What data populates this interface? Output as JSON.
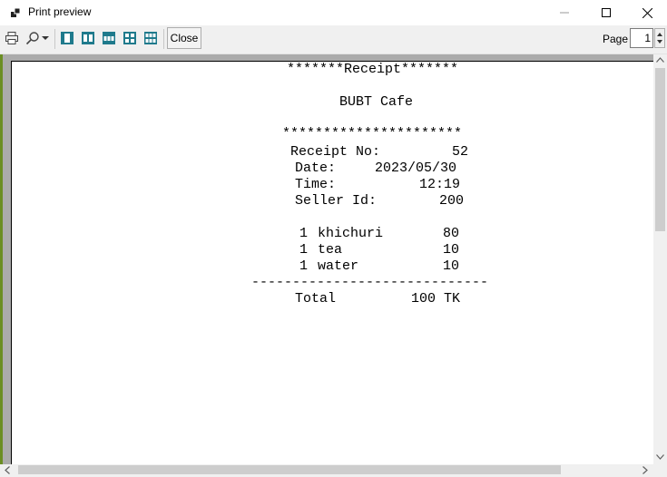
{
  "window": {
    "title": "Print preview"
  },
  "toolbar": {
    "icons": [
      "print-icon",
      "zoom-icon",
      "one-page-icon",
      "two-pages-icon",
      "three-pages-icon",
      "four-pages-icon",
      "six-pages-icon"
    ],
    "close_label": "Close",
    "page_label": "Page",
    "page_value": "1"
  },
  "receipt": {
    "header_line": "*******Receipt*******",
    "shop_name": "BUBT Cafe",
    "stars_line": "**********************",
    "receipt_no_label": "Receipt No:",
    "receipt_no_value": "52",
    "date_label": "Date:",
    "date_value": "2023/05/30",
    "time_label": "Time:",
    "time_value": "12:19",
    "seller_label": "Seller Id:",
    "seller_value": "200",
    "items": [
      {
        "qty": "1",
        "name": "khichuri",
        "price": "80"
      },
      {
        "qty": "1",
        "name": "tea",
        "price": "10"
      },
      {
        "qty": "1",
        "name": "water",
        "price": "10"
      }
    ],
    "divider": "-----------------------------",
    "total_label": "Total",
    "total_value": "100 TK"
  }
}
